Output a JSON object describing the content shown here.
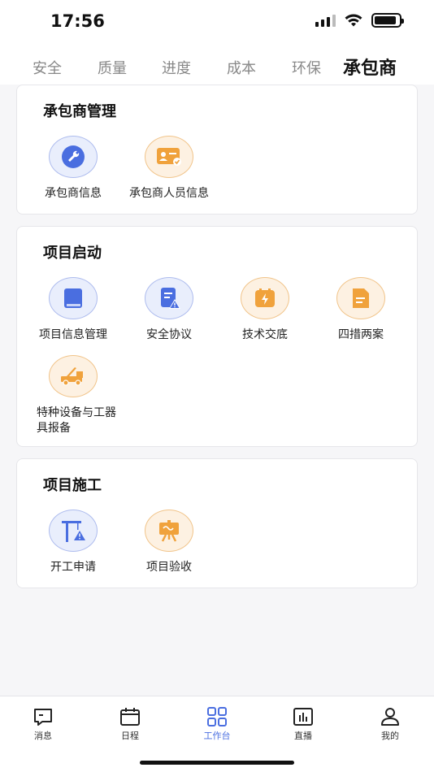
{
  "status_bar": {
    "time": "17:56"
  },
  "tabs": [
    {
      "label": "安全",
      "active": false
    },
    {
      "label": "质量",
      "active": false
    },
    {
      "label": "进度",
      "active": false
    },
    {
      "label": "成本",
      "active": false
    },
    {
      "label": "环保",
      "active": false
    },
    {
      "label": "承包商",
      "active": true
    }
  ],
  "sections": [
    {
      "title": "承包商管理",
      "items": [
        {
          "label": "承包商信息",
          "icon": "wrench-icon",
          "color": "blue"
        },
        {
          "label": "承包商人员信息",
          "icon": "id-card-icon",
          "color": "orange"
        }
      ]
    },
    {
      "title": "项目启动",
      "items": [
        {
          "label": "项目信息管理",
          "icon": "book-icon",
          "color": "blue"
        },
        {
          "label": "安全协议",
          "icon": "document-warning-icon",
          "color": "blue"
        },
        {
          "label": "技术交底",
          "icon": "lightning-icon",
          "color": "orange"
        },
        {
          "label": "四措两案",
          "icon": "file-icon",
          "color": "orange"
        },
        {
          "label": "特种设备与工器具报备",
          "icon": "crane-truck-icon",
          "color": "orange"
        }
      ]
    },
    {
      "title": "项目施工",
      "items": [
        {
          "label": "开工申请",
          "icon": "tower-crane-icon",
          "color": "blue"
        },
        {
          "label": "项目验收",
          "icon": "presentation-board-icon",
          "color": "orange"
        }
      ]
    }
  ],
  "bottom_nav": [
    {
      "label": "消息",
      "icon": "message-icon",
      "active": false
    },
    {
      "label": "日程",
      "icon": "calendar-icon",
      "active": false
    },
    {
      "label": "工作台",
      "icon": "grid-icon",
      "active": true
    },
    {
      "label": "直播",
      "icon": "chart-icon",
      "active": false
    },
    {
      "label": "我的",
      "icon": "user-icon",
      "active": false
    }
  ],
  "colors": {
    "accent_blue": "#4a6ee0",
    "accent_orange": "#f0a23c"
  }
}
